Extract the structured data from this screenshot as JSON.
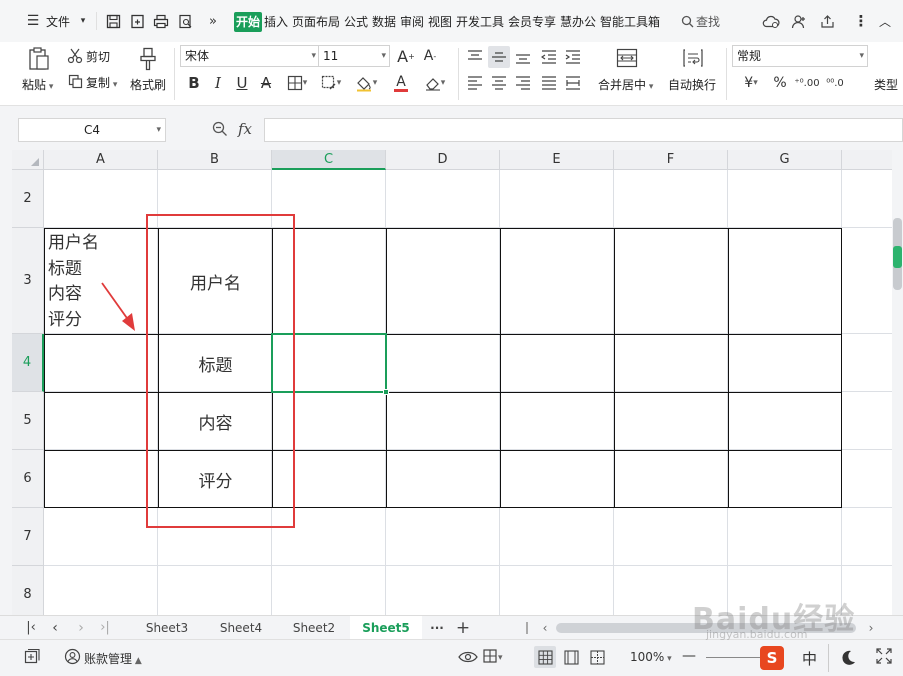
{
  "menubar": {
    "file_label": "文件",
    "tabs": [
      "开始",
      "插入",
      "页面布局",
      "公式",
      "数据",
      "审阅",
      "视图",
      "开发工具",
      "会员专享",
      "慧办公",
      "智能工具箱"
    ],
    "search_label": "查找"
  },
  "ribbon": {
    "paste_label": "粘贴",
    "cut_label": "剪切",
    "copy_label": "复制",
    "format_painter_label": "格式刷",
    "font_name": "宋体",
    "font_size": "11",
    "bold_label": "B",
    "italic_label": "I",
    "underline_label": "U",
    "font_color_label": "A",
    "merge_label": "合并居中",
    "wrap_label": "自动换行",
    "number_format": "常规",
    "currency_label": "¥",
    "percent_label": "%",
    "inc_decimal_label": "⁺⁰.00",
    "dec_decimal_label": "⁰⁰.0",
    "type_convert_label": "类型"
  },
  "formula_bar": {
    "name_box": "C4",
    "fx_label": "fx",
    "content": ""
  },
  "grid": {
    "columns": [
      "A",
      "B",
      "C",
      "D",
      "E",
      "F",
      "G"
    ],
    "selected_column": "C",
    "rows": [
      "2",
      "3",
      "4",
      "5",
      "6",
      "7",
      "8"
    ],
    "selected_row": "4",
    "cells": {
      "A3": [
        "用户名",
        "标题",
        "内容",
        "评分"
      ],
      "B3": "用户名",
      "B4": "标题",
      "B5": "内容",
      "B6": "评分"
    },
    "annotation_color": "#e03b3b",
    "selection_color": "#1a9e5a"
  },
  "sheets": {
    "tabs": [
      "Sheet3",
      "Sheet4",
      "Sheet2",
      "Sheet5"
    ],
    "active": "Sheet5",
    "more_label": "···",
    "add_label": "+"
  },
  "status": {
    "account_label": "账款管理",
    "zoom": "100%",
    "ime_label": "中",
    "watermark": "Baidu经验",
    "watermark_url": "jingyan.baidu.com"
  }
}
